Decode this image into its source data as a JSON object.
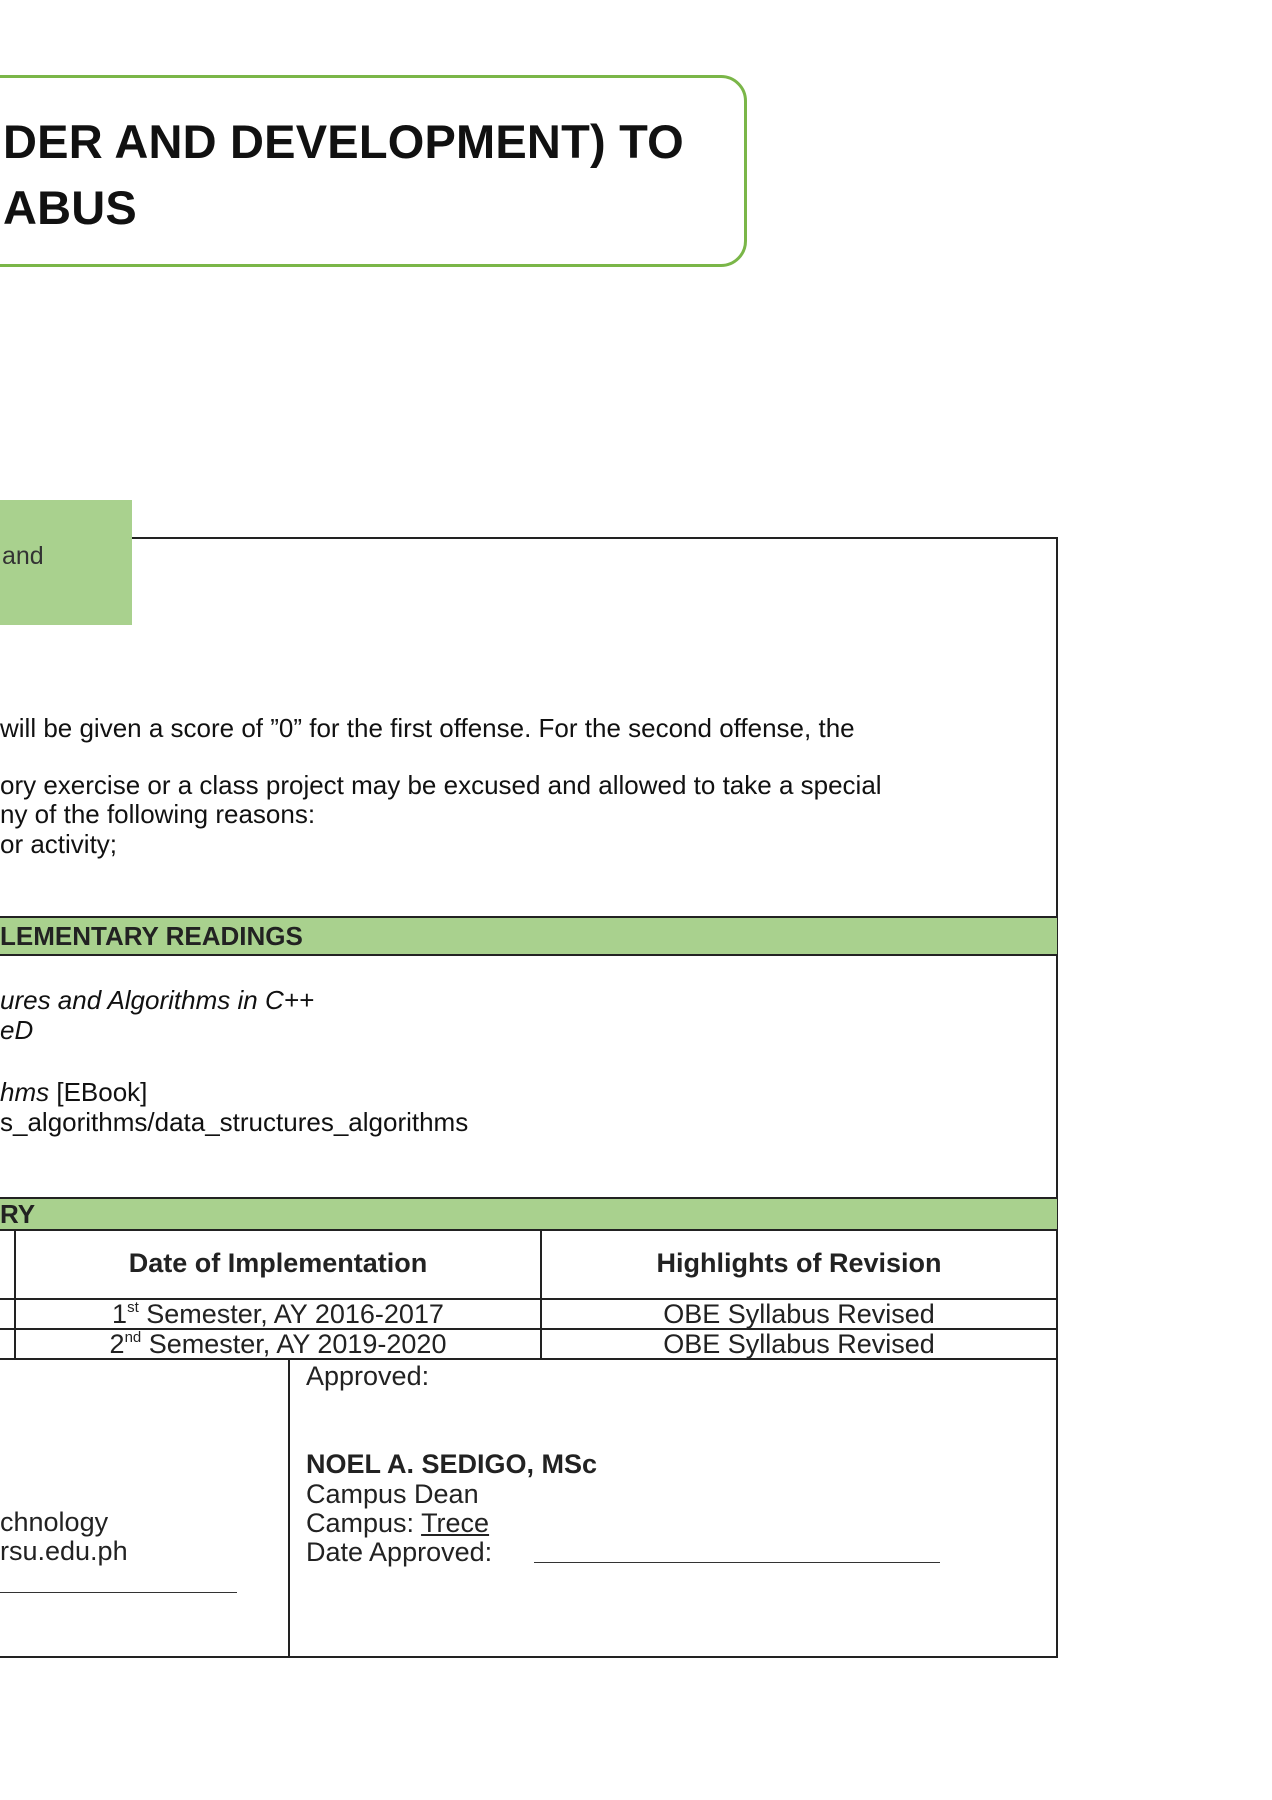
{
  "title": {
    "line1": "DER AND DEVELOPMENT) TO",
    "line2": "ABUS"
  },
  "green_label": "and",
  "policies": {
    "line1": "will be given a score of ”0” for the first offense. For the second offense, the",
    "line2": "ory exercise or a class project may be excused and allowed to take a special",
    "line3": "ny of the following reasons:",
    "line4": "or activity;"
  },
  "readings": {
    "header": "LEMENTARY READINGS",
    "ref1_title": "ures and Algorithms in C++",
    "ref1_sub": "eD",
    "ref2_title": "hms",
    "ref2_note": " [EBook]",
    "ref2_url": "s_algorithms/data_structures_algorithms"
  },
  "history": {
    "header": "RY",
    "col_date": "Date of Implementation",
    "col_highlights": "Highlights of Revision",
    "rows": [
      {
        "ord_num": "1",
        "ord_suffix": "st",
        "date": " Semester, AY 2016-2017",
        "highlight": "OBE Syllabus Revised"
      },
      {
        "ord_num": "2",
        "ord_suffix": "nd",
        "date": " Semester, AY 2019-2020",
        "highlight": "OBE Syllabus Revised"
      }
    ]
  },
  "prepared": {
    "line1": "chnology",
    "line2": "rsu.edu.ph"
  },
  "approved": {
    "label": "Approved:",
    "name": "NOEL A. SEDIGO, MSc",
    "position": "Campus Dean",
    "campus_label": "Campus: ",
    "campus_value": "Trece",
    "date_label": "Date Approved:"
  }
}
